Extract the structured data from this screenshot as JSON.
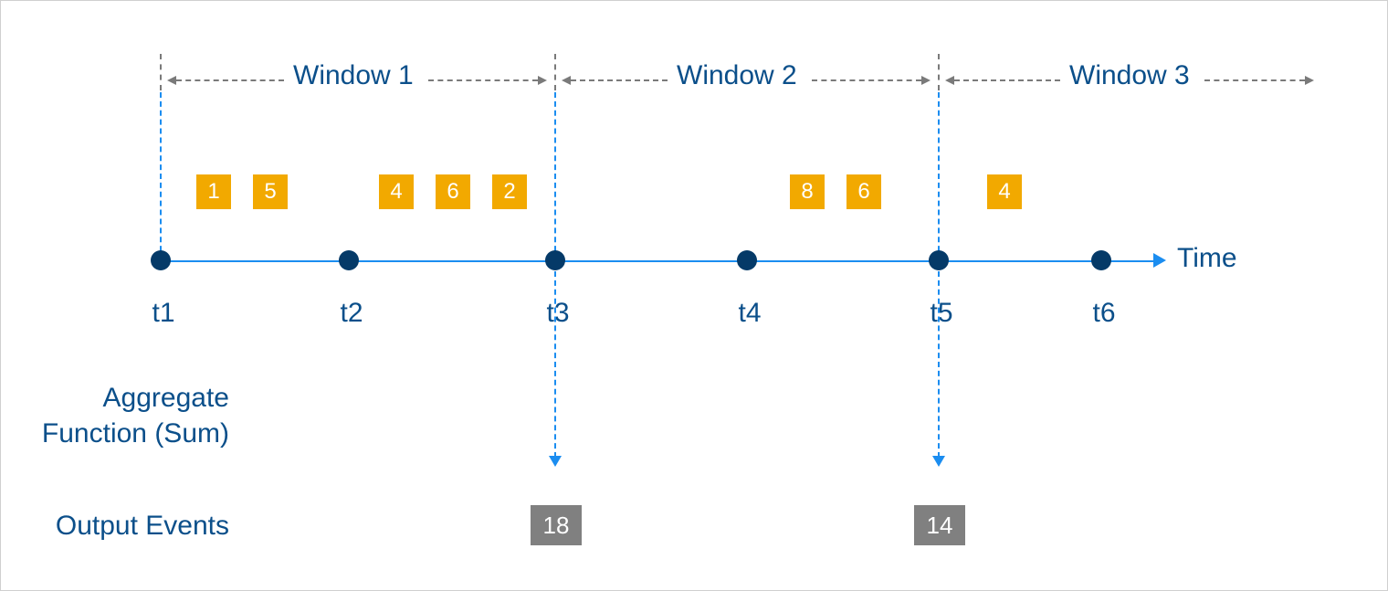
{
  "windows": [
    {
      "label": "Window 1"
    },
    {
      "label": "Window 2"
    },
    {
      "label": "Window 3"
    }
  ],
  "events": [
    {
      "value": "1"
    },
    {
      "value": "5"
    },
    {
      "value": "4"
    },
    {
      "value": "6"
    },
    {
      "value": "2"
    },
    {
      "value": "8"
    },
    {
      "value": "6"
    },
    {
      "value": "4"
    }
  ],
  "ticks": [
    {
      "label": "t1"
    },
    {
      "label": "t2"
    },
    {
      "label": "t3"
    },
    {
      "label": "t4"
    },
    {
      "label": "t5"
    },
    {
      "label": "t6"
    }
  ],
  "axis_label": "Time",
  "aggregate_label_line1": "Aggregate",
  "aggregate_label_line2": "Function (Sum)",
  "output_label": "Output Events",
  "outputs": [
    {
      "value": "18"
    },
    {
      "value": "14"
    }
  ],
  "chart_data": {
    "type": "table",
    "title": "Tumbling window aggregation (Sum)",
    "time_ticks": [
      "t1",
      "t2",
      "t3",
      "t4",
      "t5",
      "t6"
    ],
    "windows": [
      {
        "name": "Window 1",
        "start": "t1",
        "end": "t3",
        "events": [
          1,
          5,
          4,
          6,
          2
        ],
        "sum": 18
      },
      {
        "name": "Window 2",
        "start": "t3",
        "end": "t5",
        "events": [
          8,
          6
        ],
        "sum": 14
      },
      {
        "name": "Window 3",
        "start": "t5",
        "end": null,
        "events": [
          4
        ],
        "sum": null
      }
    ],
    "aggregate_function": "Sum"
  }
}
